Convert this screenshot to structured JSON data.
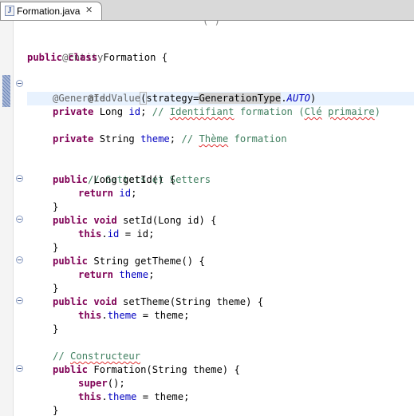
{
  "tab": {
    "label": "Formation.java",
    "icon_letter": "J"
  },
  "code": {
    "top_fragment": "( )",
    "l_entity": "@Entity",
    "l_class_kw": "public class",
    "l_class_name": " Formation {",
    "l_id": "@Id",
    "l_gv_name": "@GeneratedValue",
    "l_gv_paren": "(",
    "l_gv_strategy": "strategy=",
    "l_gv_type": "GenerationType",
    "l_gv_dot": ".",
    "l_gv_auto": "AUTO",
    "l_gv_close": ")",
    "l_private": "private",
    "l_long_type": " Long ",
    "l_id_field": "id",
    "l_semi": ";",
    "l_cm_slashes": " // ",
    "l_cm_identifiant": "Identifiant",
    "l_cm_formation": " formation (",
    "l_cm_cle": "Clé",
    "l_cm_space": " ",
    "l_cm_primaire": "primaire",
    "l_cm_close": ")",
    "l_string_type": " String ",
    "l_theme_field": "theme",
    "l_cm2_slashes": " // ",
    "l_cm2_theme": "Thème",
    "l_cm2_formation": " formation",
    "l_getset_cm": "// Getters et Setters",
    "l_public": "public",
    "l_getid_sig": " Long getId() {",
    "l_return": "return",
    "l_space": " ",
    "l_close_brace": "}",
    "l_public_void": "public void",
    "l_setid_sig": " setId(Long id) {",
    "l_this": "this",
    "l_dot": ".",
    "l_assign_id": " = id;",
    "l_gettheme_sig": " String getTheme() {",
    "l_settheme_sig": " setTheme(String theme) {",
    "l_assign_theme": " = theme;",
    "l_cm3_slashes": "// ",
    "l_cm3_constructeur": "Constructeur",
    "l_ctor_sig": " Formation(String theme) {",
    "l_super": "super",
    "l_super_rest": "();"
  },
  "colors": {
    "keyword": "#7f0055",
    "annotation": "#646464",
    "comment": "#3f7f5f",
    "field": "#0000c0",
    "current_line": "#e8f2fe"
  }
}
